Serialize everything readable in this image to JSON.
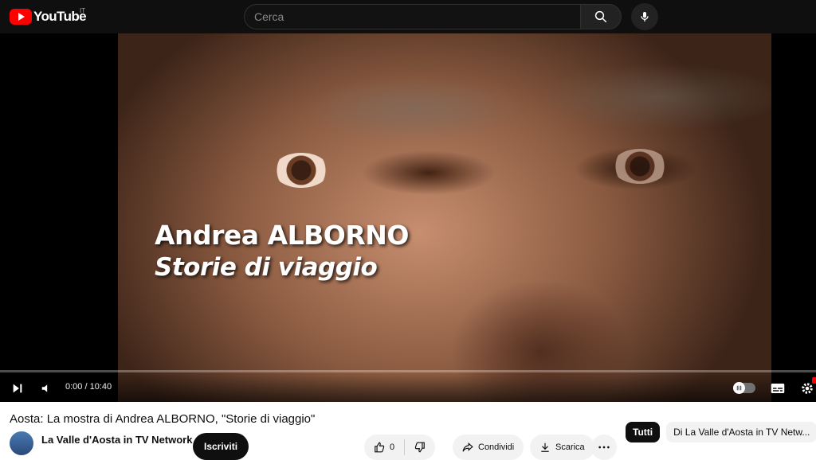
{
  "header": {
    "logo_text": "YouTube",
    "country_code": "IT",
    "search_placeholder": "Cerca",
    "icons": [
      "youtube-logo-icon",
      "search-icon",
      "microphone-icon"
    ]
  },
  "player": {
    "overlay_line1": "Andrea ALBORNO",
    "overlay_line2": "Storie di viaggio",
    "time_display": "0:00 / 10:40",
    "progress": 0.0,
    "autoplay": false,
    "controls_icons": [
      "next-icon",
      "volume-icon",
      "autoplay-toggle",
      "subtitles-icon",
      "settings-icon"
    ]
  },
  "video": {
    "title": "Aosta: La mostra di Andrea ALBORNO, \"Storie di viaggio\"",
    "channel_name": "La Valle d'Aosta in TV Network",
    "subscribe_label": "Iscriviti",
    "like_count": "0",
    "share_label": "Condividi",
    "download_label": "Scarica"
  },
  "chips": [
    {
      "label": "Tutti",
      "active": true
    },
    {
      "label": "Di La Valle d'Aosta in TV Netw...",
      "active": false
    }
  ],
  "colors": {
    "header_bg": "#0f0f0f",
    "brand_red": "#ff0000",
    "chip_bg": "#f2f2f2"
  }
}
